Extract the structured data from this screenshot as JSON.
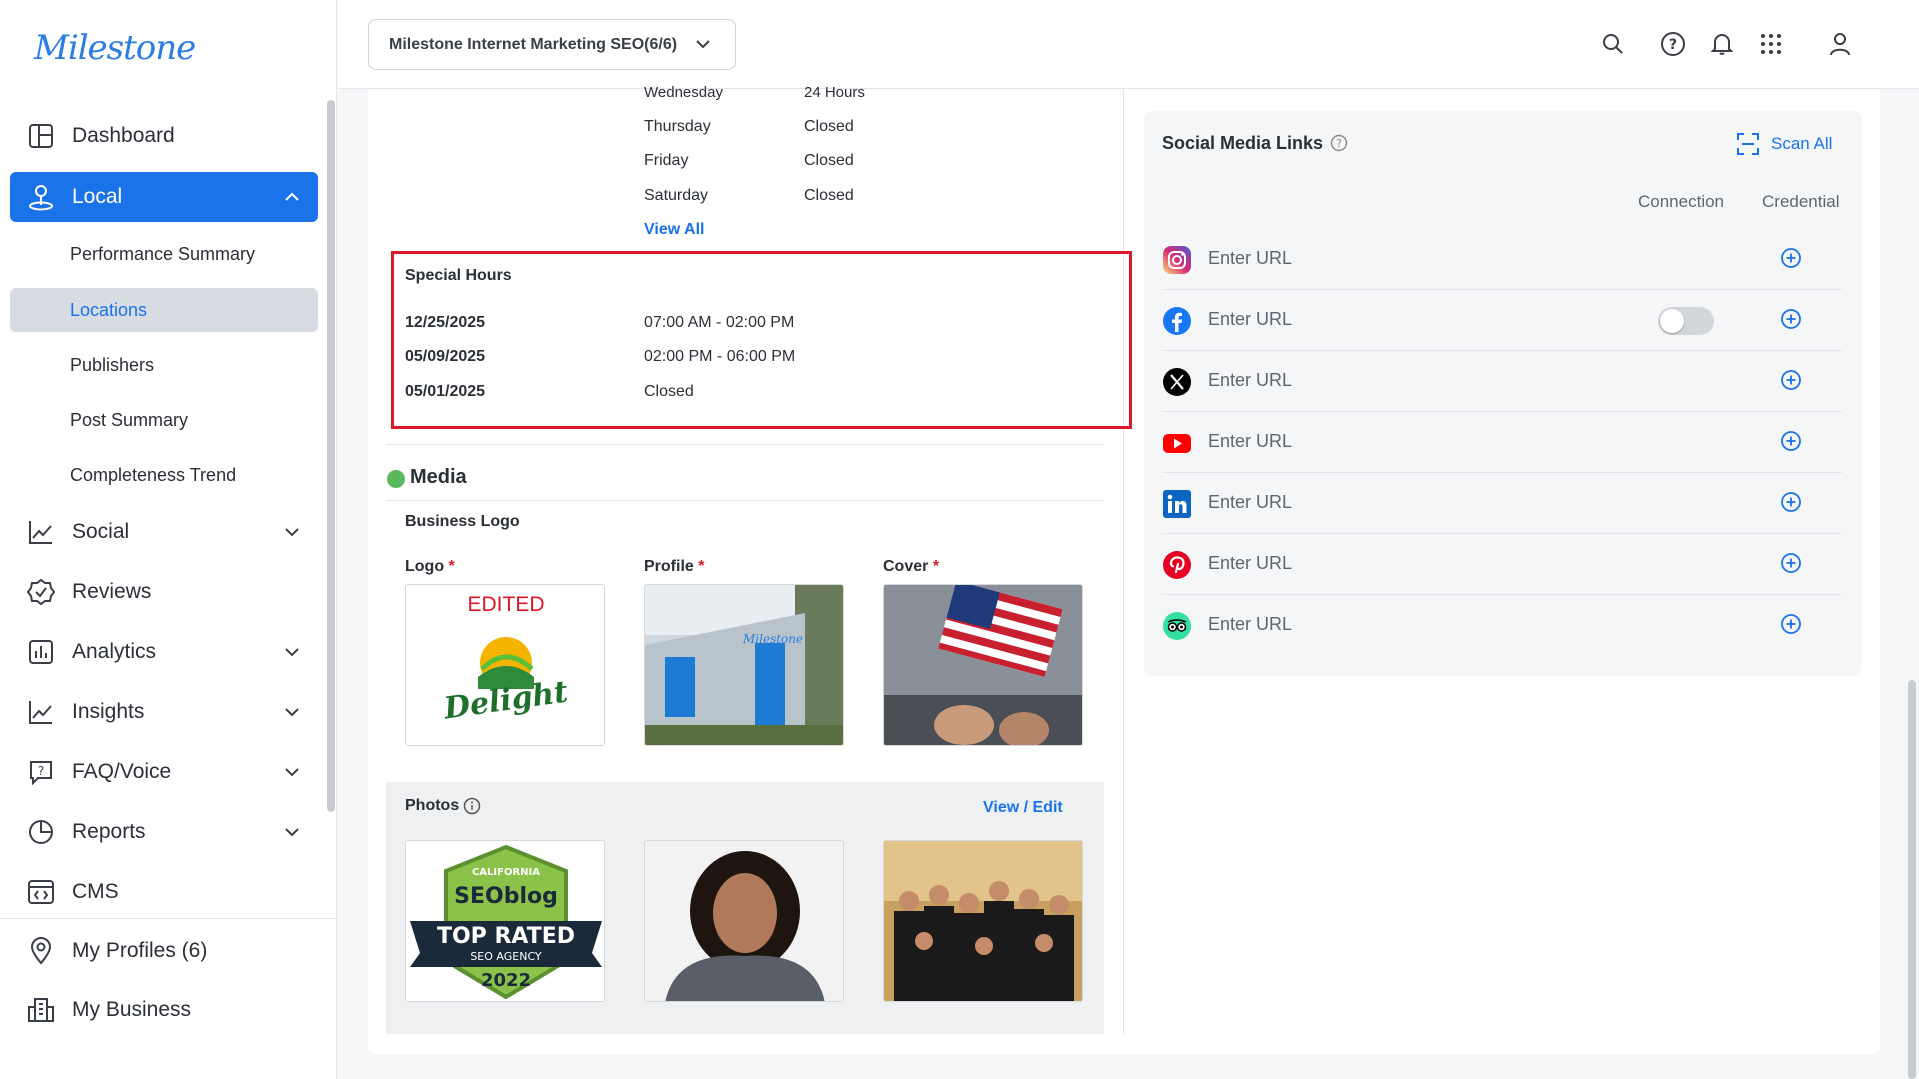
{
  "brand": {
    "logo_text": "Milestone",
    "accent": "#1a73e8"
  },
  "sidebar": {
    "items": [
      {
        "label": "Dashboard",
        "icon": "dashboard-icon"
      },
      {
        "label": "Local",
        "icon": "location-pin-icon"
      },
      {
        "label": "Social",
        "icon": "line-chart-icon"
      },
      {
        "label": "Reviews",
        "icon": "check-badge-icon"
      },
      {
        "label": "Analytics",
        "icon": "bar-chart-icon"
      },
      {
        "label": "Insights",
        "icon": "trend-icon"
      },
      {
        "label": "FAQ/Voice",
        "icon": "faq-icon"
      },
      {
        "label": "Reports",
        "icon": "pie-chart-icon"
      },
      {
        "label": "CMS",
        "icon": "code-window-icon"
      },
      {
        "label": "My Profiles (6)",
        "icon": "map-pin-icon"
      },
      {
        "label": "My Business",
        "icon": "building-icon"
      }
    ],
    "local_subitems": [
      {
        "label": "Performance Summary"
      },
      {
        "label": "Locations"
      },
      {
        "label": "Publishers"
      },
      {
        "label": "Post Summary"
      },
      {
        "label": "Completeness Trend"
      }
    ]
  },
  "header": {
    "account_selector": "Milestone Internet Marketing SEO(6/6)",
    "icons": [
      "search-icon",
      "help-icon",
      "bell-icon",
      "apps-grid-icon",
      "user-icon"
    ]
  },
  "hours": {
    "rows": [
      {
        "day": "Wednesday",
        "value": "24 Hours"
      },
      {
        "day": "Thursday",
        "value": "Closed"
      },
      {
        "day": "Friday",
        "value": "Closed"
      },
      {
        "day": "Saturday",
        "value": "Closed"
      }
    ],
    "view_all": "View All"
  },
  "special_hours": {
    "title": "Special Hours",
    "rows": [
      {
        "date": "12/25/2025",
        "value": "07:00 AM - 02:00 PM"
      },
      {
        "date": "05/09/2025",
        "value": "02:00 PM - 06:00 PM"
      },
      {
        "date": "05/01/2025",
        "value": "Closed"
      }
    ]
  },
  "media": {
    "title": "Media",
    "business_logo_label": "Business Logo",
    "logo_label": "Logo",
    "profile_label": "Profile",
    "cover_label": "Cover",
    "required_mark": "*",
    "logo_image": {
      "edited_text": "EDITED",
      "brand_text": "Delight"
    },
    "photos_label": "Photos",
    "photos_link": "View / Edit",
    "badge": {
      "state": "CALIFORNIA",
      "brand": "SEOblog",
      "line1": "TOP RATED",
      "line2": "SEO AGENCY",
      "year": "2022"
    },
    "building_sign": "Milestone"
  },
  "social_links": {
    "title": "Social Media Links",
    "scan_all": "Scan All",
    "col_connection": "Connection",
    "col_credential": "Credential",
    "rows": [
      {
        "network": "instagram-icon",
        "placeholder": "Enter URL",
        "has_toggle": false
      },
      {
        "network": "facebook-icon",
        "placeholder": "Enter URL",
        "has_toggle": true
      },
      {
        "network": "x-icon",
        "placeholder": "Enter URL",
        "has_toggle": false
      },
      {
        "network": "youtube-icon",
        "placeholder": "Enter URL",
        "has_toggle": false
      },
      {
        "network": "linkedin-icon",
        "placeholder": "Enter URL",
        "has_toggle": false
      },
      {
        "network": "pinterest-icon",
        "placeholder": "Enter URL",
        "has_toggle": false
      },
      {
        "network": "tripadvisor-icon",
        "placeholder": "Enter URL",
        "has_toggle": false
      }
    ],
    "colors": {
      "instagram": "#d6249f",
      "facebook": "#1877f2",
      "x": "#000000",
      "youtube": "#ff0000",
      "linkedin": "#0a66c2",
      "pinterest": "#e60023",
      "tripadvisor": "#34e0a1"
    }
  }
}
